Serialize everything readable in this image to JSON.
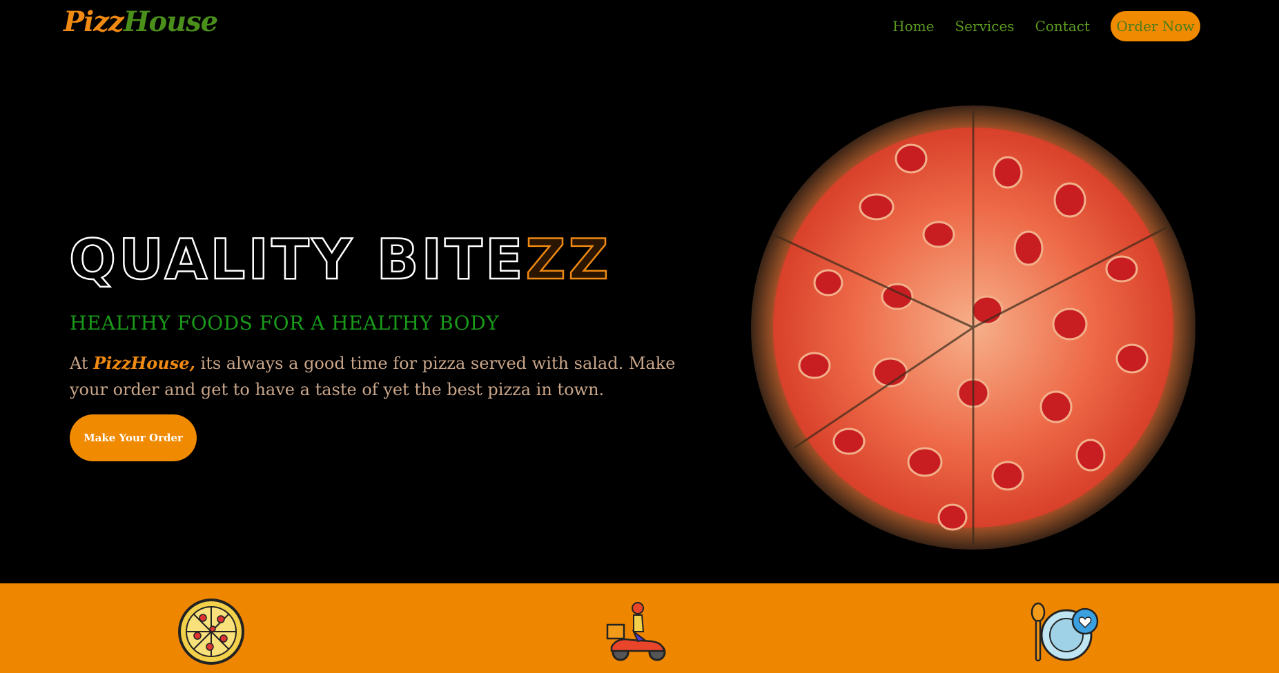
{
  "brand": {
    "name_part1": "Pizz",
    "name_part2": "House"
  },
  "nav": {
    "items": [
      "Home",
      "Services",
      "Contact"
    ],
    "order_button": "Order Now"
  },
  "hero": {
    "title_main": "QUALITY BITE",
    "title_accent": "ZZ",
    "subtitle": "HEALTHY FOODS FOR A HEALTHY BODY",
    "desc_prefix": "At ",
    "desc_brand": "PizzHouse,",
    "desc_rest": " its always a good time for pizza served with salad. Make your order and get to have a taste of yet the best pizza in town.",
    "cta_button": "Make Your Order"
  },
  "features": [
    {
      "icon": "pizza-icon"
    },
    {
      "icon": "delivery-scooter-icon"
    },
    {
      "icon": "plate-heart-icon"
    }
  ],
  "colors": {
    "accent_orange": "#f08a00",
    "brand_green": "#4a8f1a",
    "subtitle_green": "#1a9a1a",
    "background": "#000000"
  }
}
